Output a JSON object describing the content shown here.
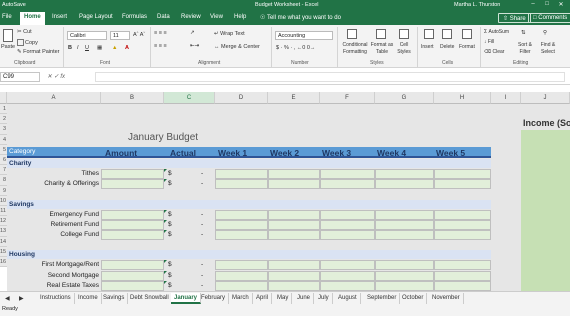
{
  "window": {
    "autosave": "AutoSave",
    "title": "Budget Worksheet - Excel",
    "user": "Martha L. Thurston"
  },
  "ribbon_tabs": [
    "File",
    "Home",
    "Insert",
    "Page Layout",
    "Formulas",
    "Data",
    "Review",
    "View",
    "Help"
  ],
  "active_tab": "Home",
  "search_placeholder": "Tell me what you want to do",
  "share_label": "Share",
  "comments_label": "Comments",
  "ribbon": {
    "paste": "Paste",
    "cut": "Cut",
    "copy": "Copy",
    "format_painter": "Format Painter",
    "font_name": "Calibri",
    "font_size": "11",
    "wrap_text": "Wrap Text",
    "merge_center": "Merge & Center",
    "number_format": "Accounting",
    "conditional_formatting": "Conditional Formatting",
    "format_as_table": "Format as Table",
    "cell_styles": "Cell Styles",
    "insert": "Insert",
    "delete": "Delete",
    "format": "Format",
    "autosum": "AutoSum",
    "fill": "Fill",
    "clear": "Clear",
    "sort_filter": "Sort & Filter",
    "find_select": "Find & Select",
    "groups": [
      "Clipboard",
      "Font",
      "Alignment",
      "Number",
      "Styles",
      "Cells",
      "Editing"
    ]
  },
  "name_box": "C99",
  "columns": [
    "A",
    "B",
    "C",
    "D",
    "E",
    "F",
    "G",
    "H",
    "I",
    "J"
  ],
  "selected_column": "C",
  "row_numbers": [
    "1",
    "2",
    "3",
    "4",
    "5",
    "6",
    "7",
    "8",
    "9",
    "10",
    "11",
    "12",
    "13",
    "14",
    "15",
    "16"
  ],
  "sheet": {
    "title": "January Budget",
    "right_header": "Income (So",
    "headers": [
      "Category",
      "Amount",
      "Actual",
      "Week 1",
      "Week 2",
      "Week 3",
      "Week 4",
      "Week 5"
    ],
    "currency_symbol": "$",
    "dash": "-",
    "sections": [
      {
        "name": "Charity",
        "items": [
          "Tithes",
          "Charity & Offerings"
        ]
      },
      {
        "name": "Savings",
        "items": [
          "Emergency Fund",
          "Retirement Fund",
          "College Fund"
        ]
      },
      {
        "name": "Housing",
        "items": [
          "First Mortgage/Rent",
          "Second Mortgage",
          "Real Estate Taxes"
        ]
      }
    ]
  },
  "sheet_tabs": [
    "Instructions",
    "Income",
    "Savings",
    "Debt Snowball",
    "January",
    "February",
    "March",
    "April",
    "May",
    "June",
    "July",
    "August",
    "September",
    "October",
    "November"
  ],
  "active_sheet": "January",
  "status": "Ready",
  "colors": {
    "excel_green": "#217346",
    "header_blue": "#5b9bd5",
    "cell_green": "#e2efda"
  }
}
